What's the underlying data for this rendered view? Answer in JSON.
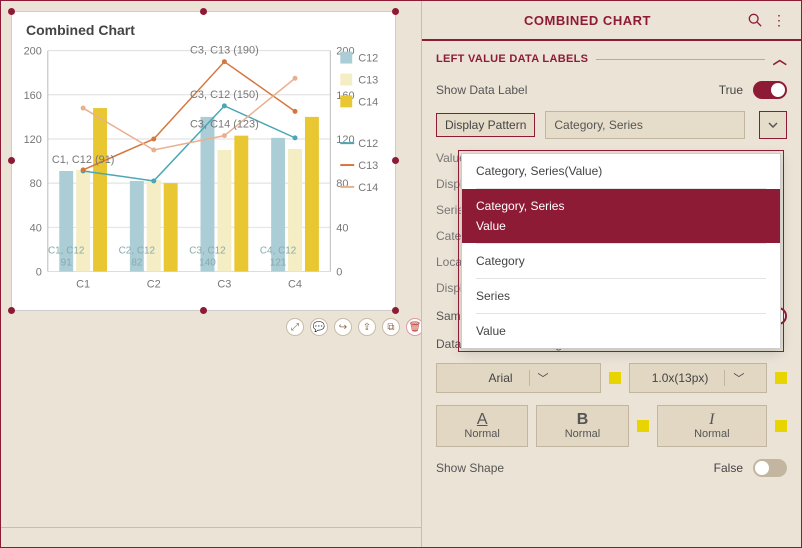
{
  "chart": {
    "title": "Combined Chart",
    "categories": [
      "C1",
      "C2",
      "C3",
      "C4"
    ],
    "left_axis": {
      "min": 0,
      "max": 200,
      "step": 40
    },
    "right_axis": {
      "min": 0,
      "max": 200,
      "step": 40
    },
    "bar_series": [
      {
        "name": "C12",
        "color": "#aacdd6",
        "values": [
          91,
          82,
          140,
          121
        ]
      },
      {
        "name": "C13",
        "color": "#f5edc4",
        "values": [
          92,
          83,
          110,
          111
        ]
      },
      {
        "name": "C14",
        "color": "#e8c733",
        "values": [
          148,
          80,
          123,
          140
        ]
      }
    ],
    "line_series": [
      {
        "name": "C12",
        "color": "#4aa7b5",
        "values": [
          91,
          82,
          150,
          121
        ]
      },
      {
        "name": "C13",
        "color": "#d6763e",
        "values": [
          92,
          120,
          190,
          145
        ]
      },
      {
        "name": "C14",
        "color": "#e9b090",
        "values": [
          148,
          110,
          123,
          175
        ]
      }
    ],
    "data_labels": [
      {
        "text": "C3, C13 (190)",
        "cat": "C3",
        "y": 190
      },
      {
        "text": "C3, C12 (150)",
        "cat": "C3",
        "y": 150
      },
      {
        "text": "C3, C14 (123)",
        "cat": "C3",
        "y": 123
      },
      {
        "text": "C1, C12 (91)",
        "cat": "C1",
        "y": 91
      }
    ],
    "bar_labels": {
      "C1": [
        "C1, C12 91",
        "",
        ""
      ],
      "C2": [
        "C2, C12 82",
        "",
        ""
      ],
      "C3": [
        "C3, C12 140",
        "",
        ""
      ],
      "C4": [
        "C4, C12 121",
        "",
        ""
      ]
    }
  },
  "chart_data": {
    "type": "bar",
    "title": "Combined Chart",
    "categories": [
      "C1",
      "C2",
      "C3",
      "C4"
    ],
    "series": [
      {
        "name": "C12 (bar)",
        "values": [
          91,
          82,
          140,
          121
        ]
      },
      {
        "name": "C13 (bar)",
        "values": [
          92,
          83,
          110,
          111
        ]
      },
      {
        "name": "C14 (bar)",
        "values": [
          148,
          80,
          123,
          140
        ]
      },
      {
        "name": "C12 (line)",
        "values": [
          91,
          82,
          150,
          121
        ]
      },
      {
        "name": "C13 (line)",
        "values": [
          92,
          120,
          190,
          145
        ]
      },
      {
        "name": "C14 (line)",
        "values": [
          148,
          110,
          123,
          175
        ]
      }
    ],
    "xlabel": "",
    "ylabel": "",
    "ylim": [
      0,
      200
    ],
    "legend": [
      "C12",
      "C13",
      "C14",
      "C12",
      "C13",
      "C14"
    ]
  },
  "panel": {
    "title": "COMBINED CHART",
    "section": "LEFT VALUE DATA LABELS",
    "show_data_label": {
      "label": "Show Data Label",
      "value": "True"
    },
    "display_pattern": {
      "label": "Display Pattern",
      "value": "Category, Series"
    },
    "dropdown_options": [
      "Category, Series(Value)",
      "Category, Series\nValue",
      "Category",
      "Series",
      "Value"
    ],
    "obscured_rows": [
      "Value",
      "Displ",
      "Serie",
      "Cate",
      "Loca",
      "Displ"
    ],
    "same_color": {
      "label": "Same Color As Legend",
      "value": "True"
    },
    "font_label": "Data Label Font Setting",
    "font_family": "Arial",
    "font_size": "1.0x(13px)",
    "btnA": "Normal",
    "btnB": "Normal",
    "btnI": "Normal",
    "show_shape": {
      "label": "Show Shape",
      "value": "False"
    }
  },
  "toolbar": {
    "expand": "⤢",
    "comment": "💬",
    "share": "↪",
    "export": "⇪",
    "copy": "⧉",
    "delete": "🗑"
  }
}
